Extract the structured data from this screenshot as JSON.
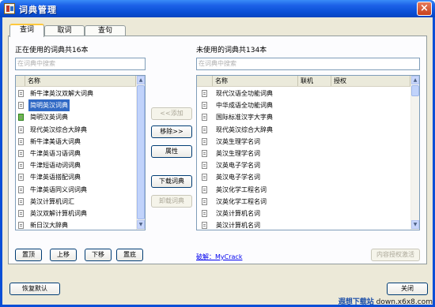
{
  "window": {
    "title": "词典管理",
    "close_glyph": "×"
  },
  "tabs": [
    {
      "label": "查词",
      "active": true
    },
    {
      "label": "取词",
      "active": false
    },
    {
      "label": "查句",
      "active": false
    }
  ],
  "left": {
    "heading": "正在使用的词典共16本",
    "search_placeholder": "在词典中搜索",
    "col_name": "名称",
    "items": [
      {
        "name": "新牛津英汉双解大词典",
        "icon": "dict-icon",
        "selected": false
      },
      {
        "name": "简明英汉词典",
        "icon": "dict-icon",
        "selected": true
      },
      {
        "name": "简明汉英词典",
        "icon": "green-dict-icon",
        "selected": false
      },
      {
        "name": "现代英汉综合大辞典",
        "icon": "dict-icon",
        "selected": false
      },
      {
        "name": "新牛津美语大词典",
        "icon": "dict-icon",
        "selected": false
      },
      {
        "name": "牛津英语习语词典",
        "icon": "dict-icon",
        "selected": false
      },
      {
        "name": "牛津短语动词词典",
        "icon": "dict-icon",
        "selected": false
      },
      {
        "name": "牛津英语搭配词典",
        "icon": "dict-icon",
        "selected": false
      },
      {
        "name": "牛津英语同义词词典",
        "icon": "dict-icon",
        "selected": false
      },
      {
        "name": "英汉计算机词汇",
        "icon": "dict-icon",
        "selected": false
      },
      {
        "name": "英汉双解计算机词典",
        "icon": "dict-icon",
        "selected": false
      },
      {
        "name": "新日汉大辞典",
        "icon": "dict-icon",
        "selected": false
      }
    ],
    "buttons": {
      "top": "置顶",
      "up": "上移",
      "down": "下移",
      "bottom": "置底"
    }
  },
  "middle": {
    "add": "<<添加",
    "remove": "移除>>",
    "properties": "属性",
    "download": "下载词典",
    "uninstall": "卸载词典"
  },
  "right": {
    "heading": "未使用的词典共134本",
    "search_placeholder": "在词典中搜索",
    "col_name": "名称",
    "col_online": "联机",
    "col_license": "授权",
    "items": [
      "现代汉语全功能词典",
      "中华成语全功能词典",
      "国际标准汉字大字典",
      "现代英汉综合大辞典",
      "汉英生理学名词",
      "英汉生理学名词",
      "汉英电子学名词",
      "英汉电子学名词",
      "英汉化学工程名词",
      "汉英化学工程名词",
      "汉英计算机名词",
      "英汉计算机名词"
    ],
    "crack_label": "破解：",
    "crack_value": "MyCrack",
    "activate_button": "内容授权激活"
  },
  "footer": {
    "restore_default": "恢复默认",
    "close": "关闭"
  },
  "watermark": {
    "brand": "遐想下载站",
    "url": "down.x6x8.com"
  }
}
